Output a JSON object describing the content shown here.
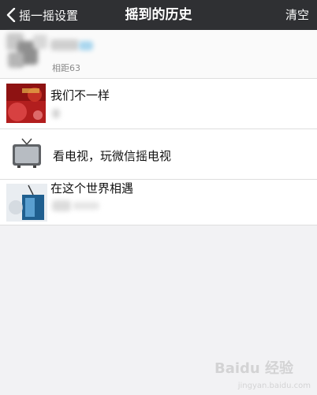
{
  "nav": {
    "back_label": "摇一摇设置",
    "title": "摇到的历史",
    "clear_label": "清空"
  },
  "rows": [
    {
      "title": "",
      "subtitle": "相距63"
    },
    {
      "title": "我们不一样",
      "subtitle": ""
    },
    {
      "title": "看电视，玩微信摇电视",
      "subtitle": ""
    },
    {
      "title": "在这个世界相遇",
      "subtitle": ""
    }
  ],
  "watermark": "Baidu 经验",
  "watermark_sub": "jingyan.baidu.com"
}
